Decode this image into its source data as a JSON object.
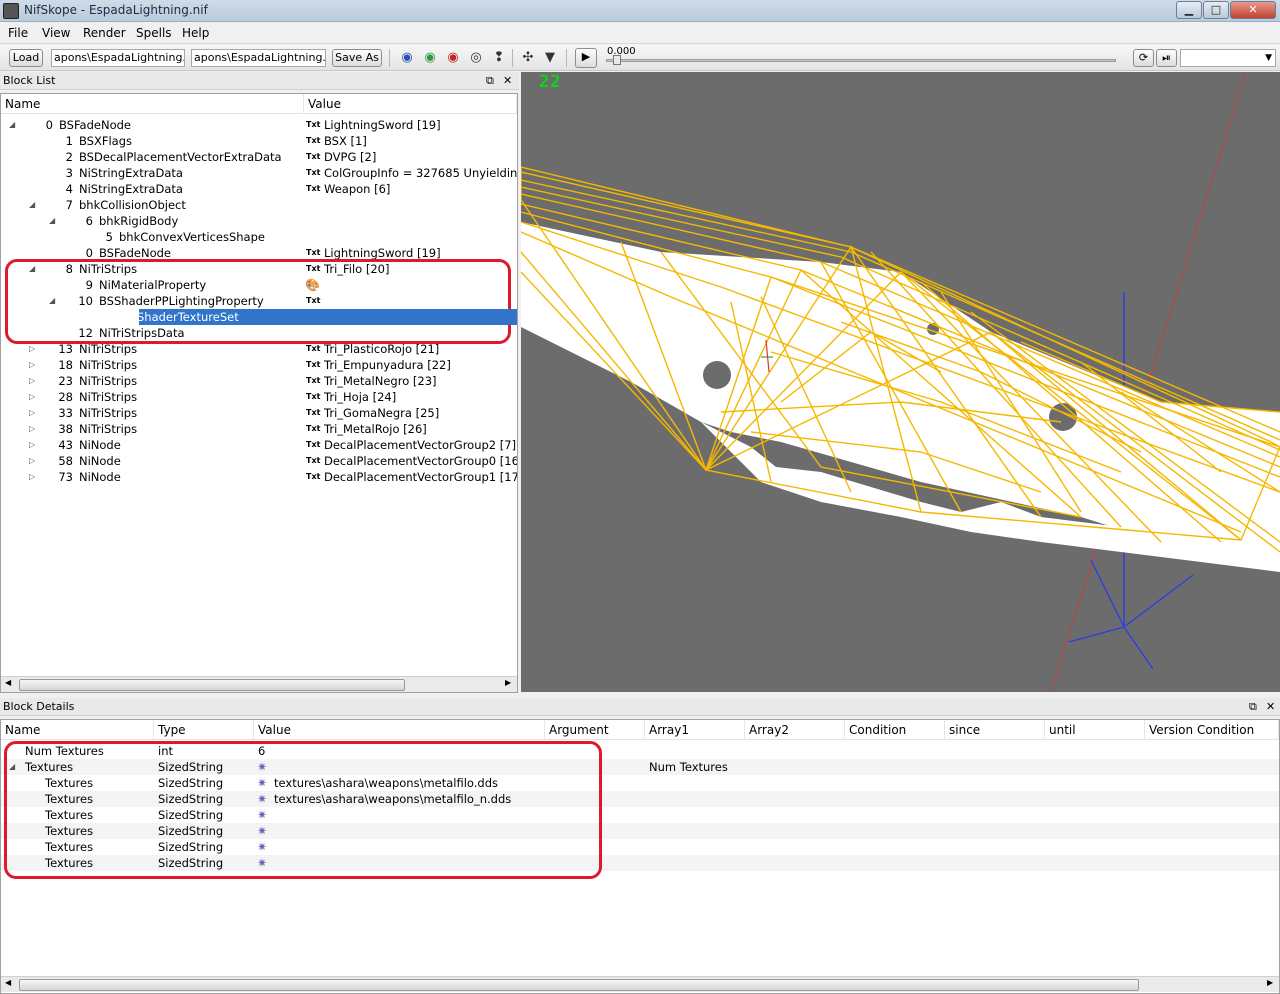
{
  "window": {
    "title": "NifSkope - EspadaLightning.nif",
    "controls": {
      "minimize": "▁",
      "maximize": "□",
      "close": "✕"
    }
  },
  "menu": [
    "File",
    "View",
    "Render",
    "Spells",
    "Help"
  ],
  "toolbar": {
    "load_label": "Load",
    "load_path": "apons\\EspadaLightning.nif",
    "save_path": "apons\\EspadaLightning.nif",
    "save_as_label": "Save As",
    "time_value": "0.000",
    "icons": [
      "eye-blue-icon",
      "eye-green-icon",
      "eye-red-icon",
      "eye-outline-icon",
      "footprint-icon",
      "axis-icon",
      "dropdown-icon",
      "play-icon",
      "loop-icon",
      "switch-icon"
    ]
  },
  "block_list": {
    "title": "Block List",
    "col_name": "Name",
    "col_value": "Value",
    "rows": [
      {
        "arrow": "◢",
        "num": "0",
        "name": "BSFadeNode",
        "txt": "Txt",
        "value": "LightningSword [19]"
      },
      {
        "arrow": "",
        "num": "1",
        "name": "BSXFlags",
        "txt": "Txt",
        "value": "BSX [1]"
      },
      {
        "arrow": "",
        "num": "2",
        "name": "BSDecalPlacementVectorExtraData",
        "txt": "Txt",
        "value": "DVPG [2]"
      },
      {
        "arrow": "",
        "num": "3",
        "name": "NiStringExtraData",
        "txt": "Txt",
        "value": "ColGroupInfo = 327685 Unyielding ="
      },
      {
        "arrow": "",
        "num": "4",
        "name": "NiStringExtraData",
        "txt": "Txt",
        "value": "Weapon [6]"
      },
      {
        "arrow": "◢",
        "num": "7",
        "name": "bhkCollisionObject",
        "txt": "",
        "value": ""
      },
      {
        "arrow": "◢",
        "num": "6",
        "name": "bhkRigidBody",
        "txt": "",
        "value": ""
      },
      {
        "arrow": "",
        "num": "5",
        "name": "bhkConvexVerticesShape",
        "txt": "",
        "value": ""
      },
      {
        "arrow": "",
        "num": "0",
        "name": "BSFadeNode",
        "txt": "Txt",
        "value": "LightningSword [19]"
      },
      {
        "arrow": "◢",
        "num": "8",
        "name": "NiTriStrips",
        "txt": "Txt",
        "value": "Tri_Filo [20]"
      },
      {
        "arrow": "",
        "num": "9",
        "name": "NiMaterialProperty",
        "txt": "",
        "value": ""
      },
      {
        "arrow": "◢",
        "num": "10",
        "name": "BSShaderPPLightingProperty",
        "txt": "Txt",
        "value": ""
      },
      {
        "arrow": "",
        "num": "11",
        "name": "BSShaderTextureSet",
        "txt": "",
        "value": ""
      },
      {
        "arrow": "",
        "num": "12",
        "name": "NiTriStripsData",
        "txt": "",
        "value": ""
      },
      {
        "arrow": "▷",
        "num": "13",
        "name": "NiTriStrips",
        "txt": "Txt",
        "value": "Tri_PlasticoRojo [21]"
      },
      {
        "arrow": "▷",
        "num": "18",
        "name": "NiTriStrips",
        "txt": "Txt",
        "value": "Tri_Empunyadura [22]"
      },
      {
        "arrow": "▷",
        "num": "23",
        "name": "NiTriStrips",
        "txt": "Txt",
        "value": "Tri_MetalNegro [23]"
      },
      {
        "arrow": "▷",
        "num": "28",
        "name": "NiTriStrips",
        "txt": "Txt",
        "value": "Tri_Hoja [24]"
      },
      {
        "arrow": "▷",
        "num": "33",
        "name": "NiTriStrips",
        "txt": "Txt",
        "value": "Tri_GomaNegra [25]"
      },
      {
        "arrow": "▷",
        "num": "38",
        "name": "NiTriStrips",
        "txt": "Txt",
        "value": "Tri_MetalRojo [26]"
      },
      {
        "arrow": "▷",
        "num": "43",
        "name": "NiNode",
        "txt": "Txt",
        "value": "DecalPlacementVectorGroup2 [7]"
      },
      {
        "arrow": "▷",
        "num": "58",
        "name": "NiNode",
        "txt": "Txt",
        "value": "DecalPlacementVectorGroup0 [16]"
      },
      {
        "arrow": "▷",
        "num": "73",
        "name": "NiNode",
        "txt": "Txt",
        "value": "DecalPlacementVectorGroup1 [17]"
      }
    ]
  },
  "viewport": {
    "fps": "22",
    "background": "#6c6c6c",
    "wire_color": "#f5b800"
  },
  "block_details": {
    "title": "Block Details",
    "columns": [
      "Name",
      "Type",
      "Value",
      "Argument",
      "Array1",
      "Array2",
      "Condition",
      "since",
      "until",
      "Version Condition"
    ],
    "rows": [
      {
        "arrow": "",
        "name": "Num Textures",
        "type": "int",
        "icon": "",
        "value": "6",
        "array1": ""
      },
      {
        "arrow": "◢",
        "name": "Textures",
        "type": "SizedString",
        "icon": "gear",
        "value": "",
        "array1": "Num Textures"
      },
      {
        "arrow": "",
        "name": "Textures",
        "type": "SizedString",
        "icon": "gear",
        "value": "textures\\ashara\\weapons\\metalfilo.dds",
        "array1": ""
      },
      {
        "arrow": "",
        "name": "Textures",
        "type": "SizedString",
        "icon": "gear",
        "value": "textures\\ashara\\weapons\\metalfilo_n.dds",
        "array1": ""
      },
      {
        "arrow": "",
        "name": "Textures",
        "type": "SizedString",
        "icon": "gear",
        "value": "",
        "array1": ""
      },
      {
        "arrow": "",
        "name": "Textures",
        "type": "SizedString",
        "icon": "gear",
        "value": "",
        "array1": ""
      },
      {
        "arrow": "",
        "name": "Textures",
        "type": "SizedString",
        "icon": "gear",
        "value": "",
        "array1": ""
      },
      {
        "arrow": "",
        "name": "Textures",
        "type": "SizedString",
        "icon": "gear",
        "value": "",
        "array1": ""
      }
    ]
  }
}
